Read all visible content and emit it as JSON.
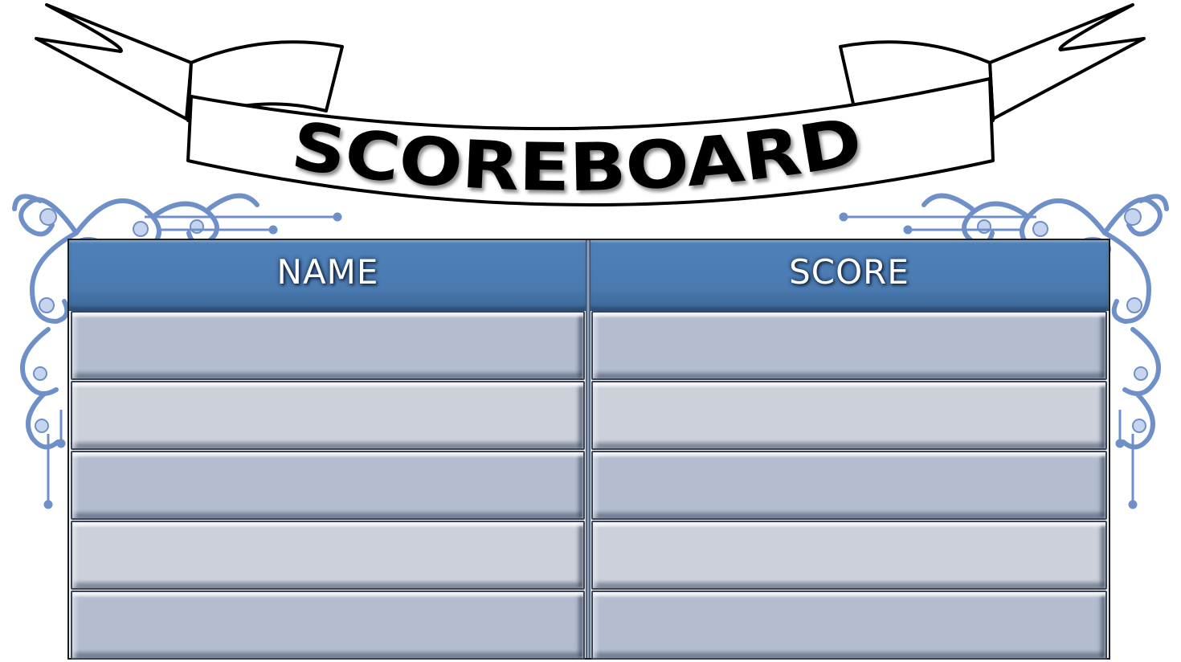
{
  "banner": {
    "title": "SCOREBOARD"
  },
  "table": {
    "headers": [
      "NAME",
      "SCORE"
    ],
    "rows": [
      {
        "name": "",
        "score": ""
      },
      {
        "name": "",
        "score": ""
      },
      {
        "name": "",
        "score": ""
      },
      {
        "name": "",
        "score": ""
      },
      {
        "name": "",
        "score": ""
      }
    ]
  },
  "colors": {
    "header_blue": "#4f81b9",
    "row_dark": "#b3bdcf",
    "row_light": "#cbd0d9",
    "ornament_blue": "#6f8fc8",
    "ribbon_outline": "#000000"
  },
  "icons": {
    "left_ornament": "ornate-scroll-icon",
    "right_ornament": "ornate-scroll-icon"
  }
}
